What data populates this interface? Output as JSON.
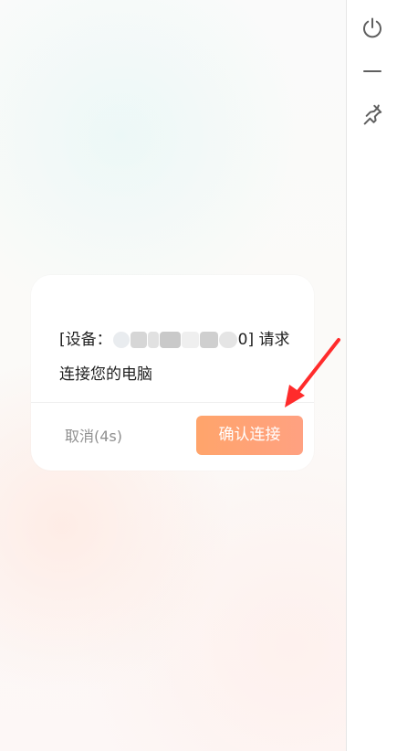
{
  "sidebar": {
    "items": [
      {
        "icon": "power-icon"
      },
      {
        "icon": "minimize-icon"
      },
      {
        "icon": "pin-icon"
      }
    ]
  },
  "dialog": {
    "message": {
      "prefix": "[设备：",
      "suffix": "0]  请求",
      "line2": "连接您的电脑"
    },
    "cancel_label": "取消(4s)",
    "confirm_label": "确认连接"
  },
  "colors": {
    "accent_start": "#ffa46b",
    "accent_end": "#ffa181",
    "annotation_arrow": "#ff2b2b"
  }
}
